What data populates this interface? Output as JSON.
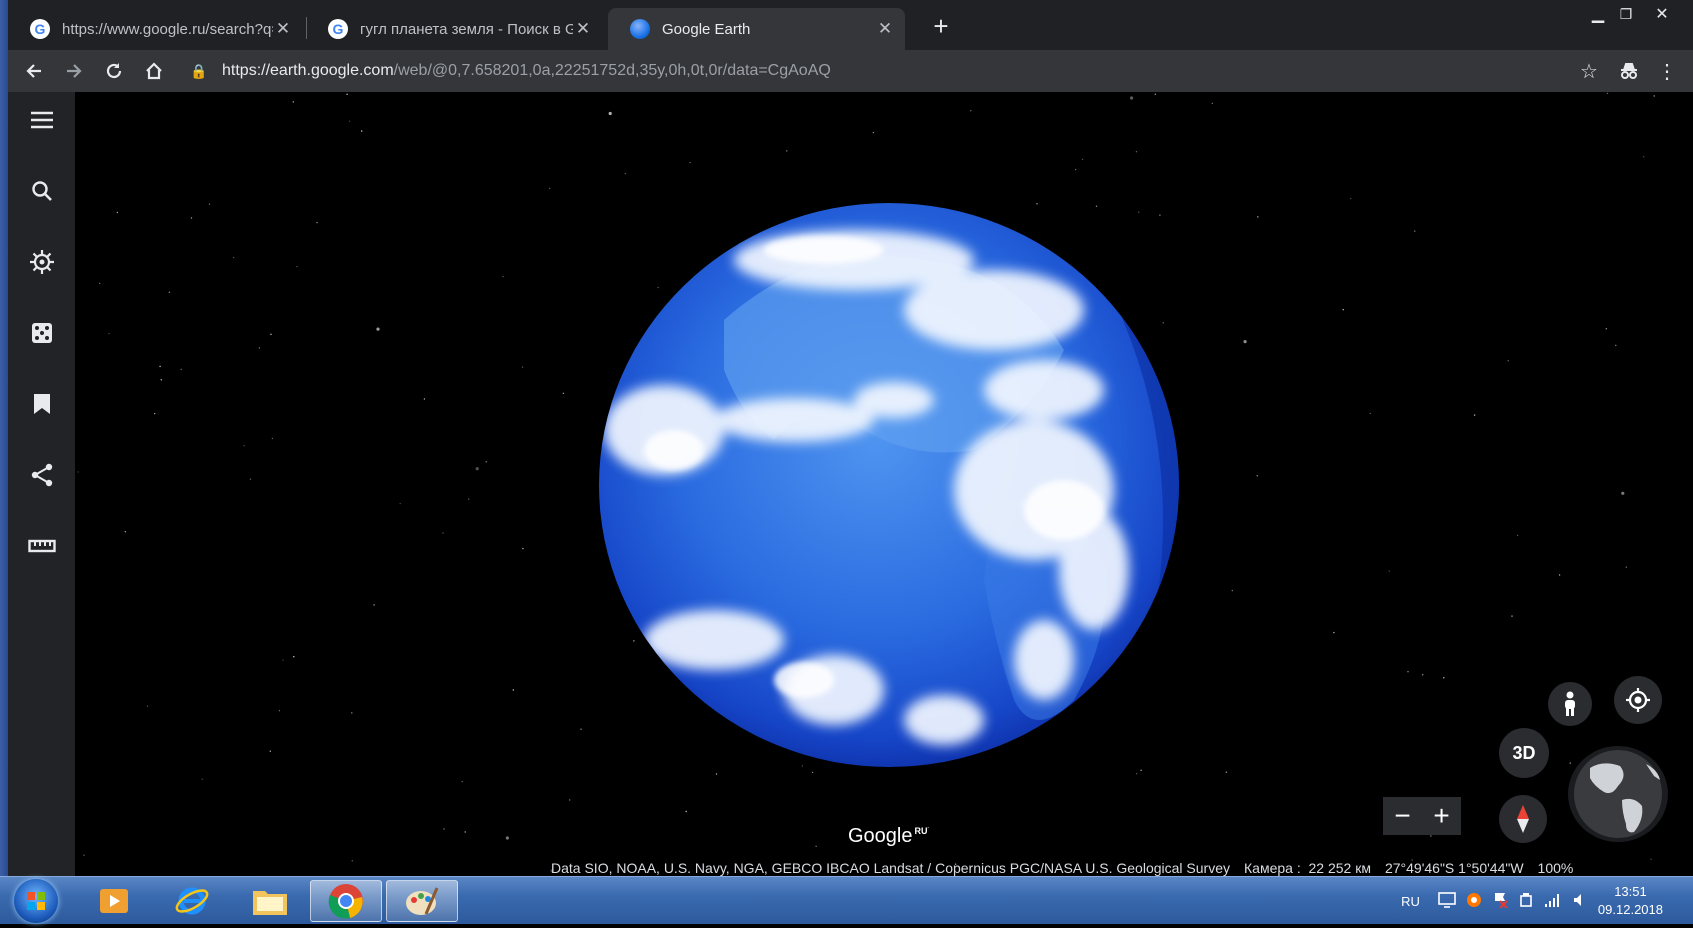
{
  "browser": {
    "tabs": [
      {
        "title": "https://www.google.ru/search?q=",
        "favicon": "google-g-icon",
        "active": false
      },
      {
        "title": "гугл планета земля - Поиск в Go",
        "favicon": "google-g-icon",
        "active": false
      },
      {
        "title": "Google Earth",
        "favicon": "earth-globe-icon",
        "active": true
      }
    ],
    "new_tab_label": "+",
    "url_host": "https://earth.google.com",
    "url_path": "/web/@0,7.658201,0a,22251752d,35y,0h,0t,0r/data=CgAoAQ"
  },
  "earth": {
    "sidebar_icons": [
      "menu-icon",
      "search-icon",
      "voyager-icon",
      "feeling-lucky-icon",
      "projects-icon",
      "share-icon",
      "measure-icon"
    ],
    "controls": {
      "view_mode_label": "3D",
      "zoom_out_label": "−",
      "zoom_in_label": "+"
    },
    "logo_text": "Google",
    "logo_region": "RU",
    "attribution": "Data SIO, NOAA, U.S. Navy, NGA, GEBCO IBCAO Landsat / Copernicus PGC/NASA U.S. Geological Survey",
    "camera_label": "Камера :",
    "camera_value": "22 252 км",
    "coordinates": "27°49'46\"S 1°50'44\"W",
    "zoom_percent": "100%"
  },
  "taskbar": {
    "language": "RU",
    "time": "13:51",
    "date": "09.12.2018",
    "apps": [
      "media-player-icon",
      "internet-explorer-icon",
      "file-explorer-icon",
      "chrome-icon",
      "paint-icon"
    ]
  },
  "colors": {
    "accent": "#1a73e8",
    "ocean": "#2f6fe0"
  }
}
